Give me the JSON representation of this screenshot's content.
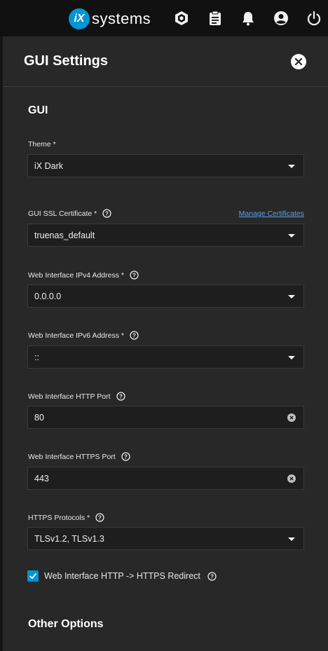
{
  "topbar": {
    "logo_mark": "iX",
    "logo_text": "systems",
    "icons": [
      "truecommand-icon",
      "clipboard-icon",
      "bell-icon",
      "account-icon",
      "power-icon"
    ]
  },
  "panel": {
    "title": "GUI Settings",
    "section_gui": "GUI",
    "section_other": "Other Options"
  },
  "fields": {
    "theme": {
      "label": "Theme *",
      "value": "iX Dark"
    },
    "ssl_cert": {
      "label": "GUI SSL Certificate *",
      "value": "truenas_default",
      "link": "Manage Certificates"
    },
    "ipv4": {
      "label": "Web Interface IPv4 Address *",
      "value": "0.0.0.0"
    },
    "ipv6": {
      "label": "Web Interface IPv6 Address *",
      "value": "::"
    },
    "http_port": {
      "label": "Web Interface HTTP Port",
      "value": "80"
    },
    "https_port": {
      "label": "Web Interface HTTPS Port",
      "value": "443"
    },
    "https_protocols": {
      "label": "HTTPS Protocols *",
      "value": "TLSv1.2, TLSv1.3"
    }
  },
  "redirect": {
    "label": "Web Interface HTTP -> HTTPS Redirect",
    "checked": true
  },
  "colors": {
    "accent": "#0095d5",
    "panel": "#282828",
    "field": "#1e1e1e",
    "link": "#5aa3e6"
  }
}
